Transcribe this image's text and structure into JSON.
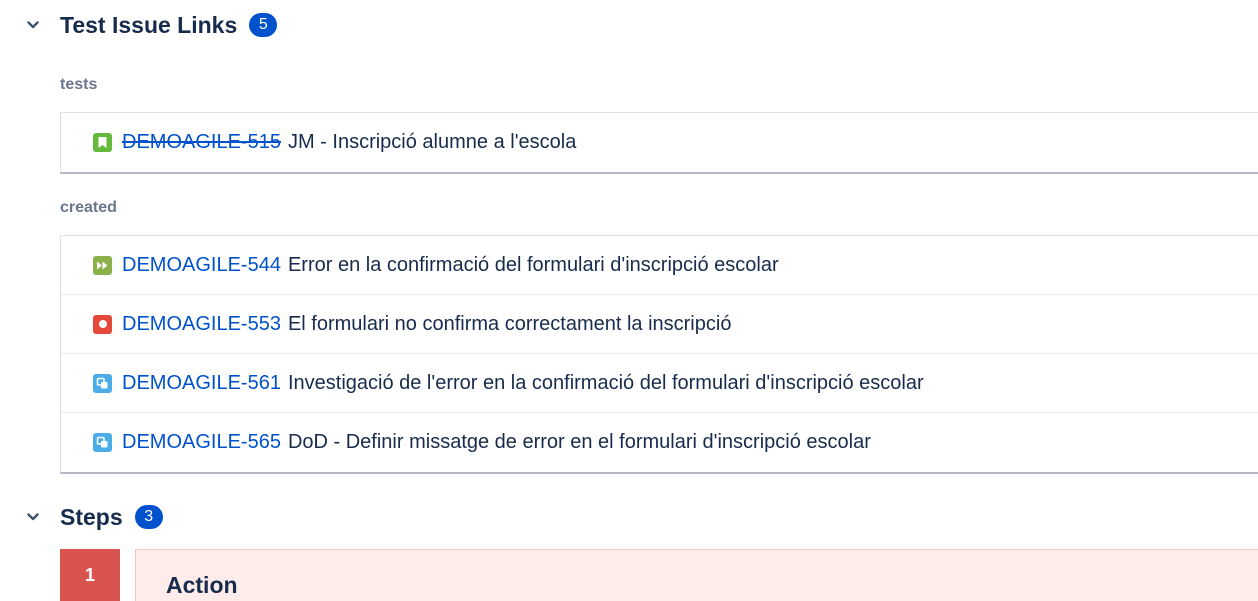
{
  "issue_links": {
    "title": "Test Issue Links",
    "count": "5",
    "groups": [
      {
        "label": "tests",
        "items": [
          {
            "key": "DEMOAGILE-515",
            "summary": "JM - Inscripció alumne a l'escola",
            "icon": "story-icon",
            "resolved": true
          }
        ]
      },
      {
        "label": "created",
        "items": [
          {
            "key": "DEMOAGILE-544",
            "summary": "Error en la confirmació del formulari d'inscripció escolar",
            "icon": "improvement-icon",
            "resolved": false
          },
          {
            "key": "DEMOAGILE-553",
            "summary": "El formulari no confirma correctament la inscripció",
            "icon": "bug-icon",
            "resolved": false
          },
          {
            "key": "DEMOAGILE-561",
            "summary": "Investigació de l'error en la confirmació del formulari d'inscripció escolar",
            "icon": "subtask-icon",
            "resolved": false
          },
          {
            "key": "DEMOAGILE-565",
            "summary": "DoD - Definir missatge de error en el formulari d'inscripció escolar",
            "icon": "subtask-icon",
            "resolved": false
          }
        ]
      }
    ]
  },
  "steps": {
    "title": "Steps",
    "count": "3",
    "first_step": {
      "number": "1",
      "action_label": "Action"
    }
  },
  "colors": {
    "link": "#0052cc",
    "badge": "#0052cc",
    "story": "#63ba3c",
    "improvement": "#8bb04a",
    "bug": "#e5493a",
    "subtask": "#4bade8",
    "step_number_bg": "#d9534f",
    "step_body_bg": "#fdecea"
  }
}
